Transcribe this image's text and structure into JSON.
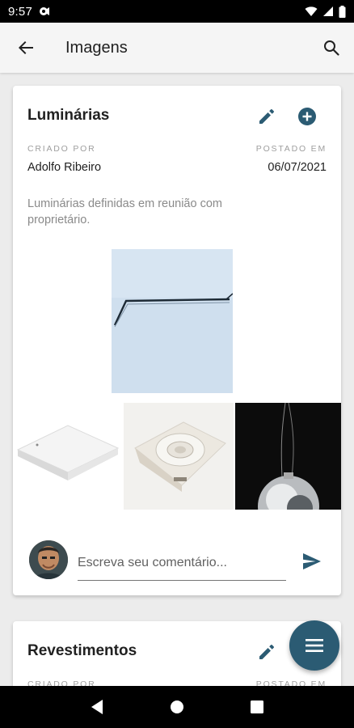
{
  "status_bar": {
    "time": "9:57"
  },
  "app_bar": {
    "title": "Imagens"
  },
  "posts": [
    {
      "title": "Luminárias",
      "created_by_label": "CRIADO POR",
      "created_by": "Adolfo Ribeiro",
      "posted_on_label": "POSTADO EM",
      "posted_on": "06/07/2021",
      "description": "Luminárias definidas em reunião com proprietário.",
      "comment_placeholder": "Escreva seu comentário..."
    },
    {
      "title": "Revestimentos",
      "created_by_label": "CRIADO POR",
      "posted_on_label": "POSTADO EM"
    }
  ],
  "colors": {
    "accent": "#2b5b73",
    "app_bar_bg": "#f5f5f5",
    "page_bg": "#ececec"
  },
  "icons": {
    "back": "arrow-back-icon",
    "search": "search-icon",
    "edit": "pencil-icon",
    "add": "add-circle-icon",
    "send": "send-icon",
    "fab": "menu-icon"
  }
}
